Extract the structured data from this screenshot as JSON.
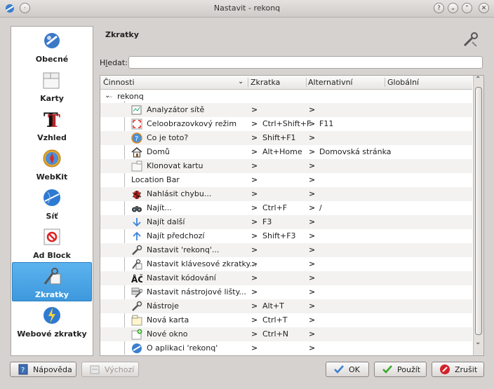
{
  "window": {
    "title": "Nastavit - rekonq"
  },
  "sidebar": {
    "items": [
      {
        "label": "Obecné",
        "icon": "general-settings-icon"
      },
      {
        "label": "Karty",
        "icon": "tabs-icon"
      },
      {
        "label": "Vzhled",
        "icon": "appearance-font-icon"
      },
      {
        "label": "WebKit",
        "icon": "webkit-compass-icon"
      },
      {
        "label": "Síť",
        "icon": "network-globe-icon"
      },
      {
        "label": "Ad Block",
        "icon": "adblock-icon"
      },
      {
        "label": "Zkratky",
        "icon": "shortcuts-icon",
        "selected": true
      },
      {
        "label": "Webové zkratky",
        "icon": "web-shortcuts-icon"
      }
    ]
  },
  "panel": {
    "heading": "Zkratky",
    "search_label_prefix": "H",
    "search_label_underlined": "l",
    "search_label_suffix": "edat:",
    "search_value": ""
  },
  "tree": {
    "headers": {
      "action": "Činnosti",
      "shortcut": "Zkratka",
      "alternative": "Alternativní",
      "global": "Globální"
    },
    "root": "rekonq",
    "rows": [
      {
        "action": "Analyzátor sítě",
        "shortcut": "",
        "alternative": "",
        "icon": "network-analyzer-icon"
      },
      {
        "action": "Celoobrazovkový režim",
        "shortcut": "Ctrl+Shift+F",
        "alternative": "F11",
        "icon": "fullscreen-icon"
      },
      {
        "action": "Co je toto?",
        "shortcut": "Shift+F1",
        "alternative": "",
        "icon": "whats-this-icon"
      },
      {
        "action": "Domů",
        "shortcut": "Alt+Home",
        "alternative": "Domovská stránka",
        "icon": "home-icon"
      },
      {
        "action": "Klonovat kartu",
        "shortcut": "",
        "alternative": "",
        "icon": "clone-tab-icon"
      },
      {
        "action": "Location Bar",
        "shortcut": "",
        "alternative": "",
        "icon": ""
      },
      {
        "action": "Nahlásit chybu...",
        "shortcut": "",
        "alternative": "",
        "icon": "bug-icon"
      },
      {
        "action": "Najít...",
        "shortcut": "Ctrl+F",
        "alternative": "/",
        "icon": "binoculars-icon"
      },
      {
        "action": "Najít další",
        "shortcut": "F3",
        "alternative": "",
        "icon": "arrow-down-icon"
      },
      {
        "action": "Najít předchozí",
        "shortcut": "Shift+F3",
        "alternative": "",
        "icon": "arrow-up-icon"
      },
      {
        "action": "Nastavit 'rekonq'...",
        "shortcut": "",
        "alternative": "",
        "icon": "configure-icon"
      },
      {
        "action": "Nastavit klávesové zkratky...",
        "shortcut": "",
        "alternative": "",
        "icon": "configure-shortcuts-icon"
      },
      {
        "action": "Nastavit kódování",
        "shortcut": "",
        "alternative": "",
        "icon": "encoding-icon"
      },
      {
        "action": "Nastavit nástrojové lišty...",
        "shortcut": "",
        "alternative": "",
        "icon": "configure-toolbars-icon"
      },
      {
        "action": "Nástroje",
        "shortcut": "Alt+T",
        "alternative": "",
        "icon": "tools-icon"
      },
      {
        "action": "Nová karta",
        "shortcut": "Ctrl+T",
        "alternative": "",
        "icon": "new-tab-icon"
      },
      {
        "action": "Nové okno",
        "shortcut": "Ctrl+N",
        "alternative": "",
        "icon": "new-window-icon"
      },
      {
        "action": "O aplikaci 'rekonq'",
        "shortcut": "",
        "alternative": "",
        "icon": "about-rekonq-icon"
      }
    ]
  },
  "buttons": {
    "help": "Nápověda",
    "defaults": "Výchozí",
    "ok": "OK",
    "apply": "Použít",
    "cancel": "Zrušit"
  },
  "colors": {
    "selection": "#3d98dd",
    "ok_check": "#3aa82e",
    "cancel_red": "#d2232a"
  }
}
